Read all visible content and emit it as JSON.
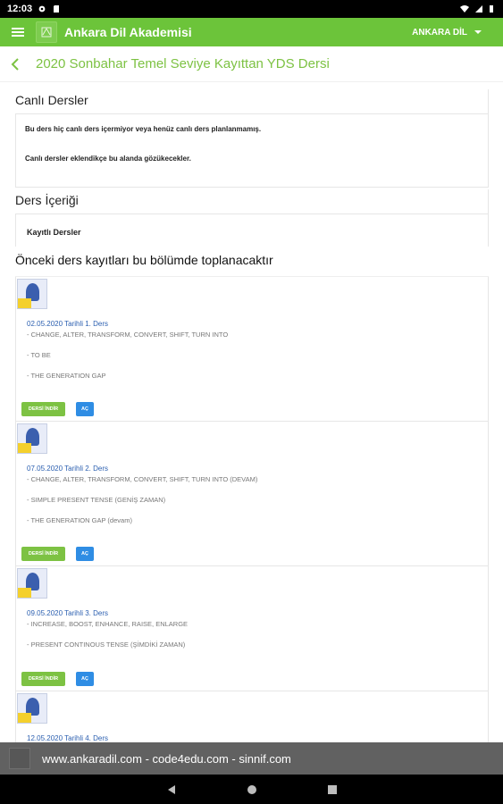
{
  "status_bar": {
    "time": "12:03"
  },
  "app_bar": {
    "title": "Ankara Dil Akademisi",
    "user_label": "ANKARA DİL"
  },
  "page_header": {
    "title": "2020 Sonbahar Temel Seviye Kayıttan YDS Dersi"
  },
  "live": {
    "title": "Canlı Dersler",
    "message_1": "Bu ders hiç canlı ders içermiyor veya henüz canlı ders planlanmamış.",
    "message_2": "Canlı dersler eklendikçe bu alanda gözükecekler."
  },
  "content": {
    "title": "Ders İçeriği",
    "recorded_label": "Kayıtlı Dersler",
    "previous_title": "Önceki ders kayıtları bu bölümde toplanacaktır"
  },
  "buttons": {
    "download": "DERSİ İNDİR",
    "open": "AÇ"
  },
  "lessons": [
    {
      "date": "02.05.2020 Tarihli 1. Ders",
      "topics": [
        "- CHANGE, ALTER, TRANSFORM, CONVERT, SHIFT, TURN INTO",
        "- TO BE",
        "- THE GENERATION GAP"
      ]
    },
    {
      "date": "07.05.2020 Tarihli 2. Ders",
      "topics": [
        "- CHANGE, ALTER, TRANSFORM, CONVERT, SHIFT, TURN INTO (DEVAM)",
        "- SIMPLE PRESENT TENSE (GENİŞ ZAMAN)",
        "- THE GENERATION GAP (devam)"
      ]
    },
    {
      "date": "09.05.2020 Tarihli 3. Ders",
      "topics": [
        "- INCREASE, BOOST, ENHANCE, RAISE, ENLARGE",
        "- PRESENT CONTINOUS TENSE (ŞİMDİKİ ZAMAN)"
      ]
    },
    {
      "date": "12.05.2020 Tarihli 4. Ders",
      "topics": []
    }
  ],
  "footer": {
    "text": "www.ankaradil.com - code4edu.com - sinnif.com"
  }
}
